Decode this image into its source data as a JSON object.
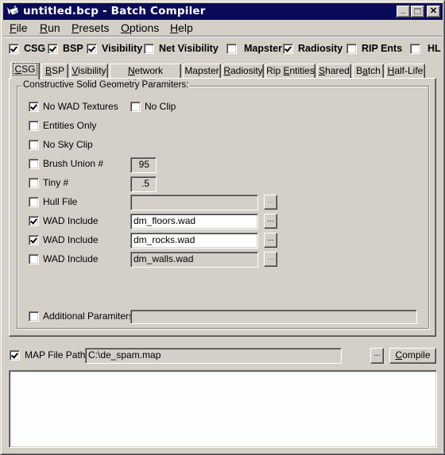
{
  "window": {
    "title": "untitled.bcp - Batch Compiler",
    "icon": "app-icon",
    "controls": {
      "minimize": "_",
      "maximize": "□",
      "close": "✕"
    }
  },
  "menu": [
    {
      "label": "File",
      "accel": "F",
      "rest": "ile"
    },
    {
      "label": "Run",
      "accel": "R",
      "rest": "un"
    },
    {
      "label": "Presets",
      "accel": "P",
      "rest": "resets"
    },
    {
      "label": "Options",
      "accel": "O",
      "rest": "ptions"
    },
    {
      "label": "Help",
      "accel": "H",
      "rest": "elp"
    }
  ],
  "stages": [
    {
      "label": "CSG",
      "checked": true
    },
    {
      "label": "BSP",
      "checked": true
    },
    {
      "label": "Visibility",
      "checked": true
    },
    {
      "label": "Net Visibility",
      "checked": false
    },
    {
      "label": "Mapster",
      "checked": false
    },
    {
      "label": "Radiosity",
      "checked": true
    },
    {
      "label": "RIP Ents",
      "checked": false
    },
    {
      "label": "HL",
      "checked": false
    }
  ],
  "tabs": [
    {
      "label": "CSG",
      "accel": "C",
      "rest": "SG",
      "active": true
    },
    {
      "label": "BSP",
      "accel": "B",
      "rest": "SP",
      "active": false
    },
    {
      "label": "Visibility",
      "accel": "V",
      "rest": "isibility",
      "active": false
    },
    {
      "label": "Network Visibility",
      "accel": "N",
      "rest": "etwork Visibility",
      "active": false
    },
    {
      "label": "Mapster",
      "accel": "",
      "rest": "Mapster",
      "active": false
    },
    {
      "label": "Radiosity",
      "accel": "R",
      "rest": "adiosity",
      "active": false
    },
    {
      "label": "Rip Entities",
      "pre": "Rip ",
      "accel": "E",
      "rest": "ntities",
      "active": false
    },
    {
      "label": "Shared",
      "accel": "S",
      "rest": "hared",
      "active": false
    },
    {
      "label": "Batch",
      "pre": "B",
      "accel": "a",
      "rest": "tch",
      "active": false
    },
    {
      "label": "Half-Life",
      "accel": "H",
      "rest": "alf-Life",
      "active": false
    }
  ],
  "csg": {
    "group_title": "Constructive Solid Geometry Paramiters:",
    "no_wad_textures": {
      "label": "No WAD Textures",
      "checked": true
    },
    "no_clip": {
      "label": "No Clip",
      "checked": false
    },
    "entities_only": {
      "label": "Entities Only",
      "checked": false
    },
    "no_sky_clip": {
      "label": "No Sky Clip",
      "checked": false
    },
    "brush_union": {
      "label": "Brush Union #",
      "checked": false,
      "value": "95"
    },
    "tiny": {
      "label": "Tiny #",
      "checked": false,
      "value": ".5"
    },
    "hull_file": {
      "label": "Hull File",
      "checked": false,
      "value": "",
      "browse": "..."
    },
    "wad_includes": [
      {
        "label": "WAD Include",
        "checked": true,
        "value": "dm_floors.wad",
        "browse": "..."
      },
      {
        "label": "WAD Include",
        "checked": true,
        "value": "dm_rocks.wad",
        "browse": "..."
      },
      {
        "label": "WAD Include",
        "checked": false,
        "value": "dm_walls.wad",
        "browse": "..."
      }
    ],
    "additional": {
      "label": "Additional Paramiters",
      "checked": false,
      "value": ""
    }
  },
  "map_file": {
    "label": "MAP File Path:",
    "checked": true,
    "value": "C:\\de_spam.map",
    "browse": "...",
    "compile": {
      "label": "Compile",
      "accel": "C",
      "rest": "ompile"
    }
  },
  "output_log": ""
}
